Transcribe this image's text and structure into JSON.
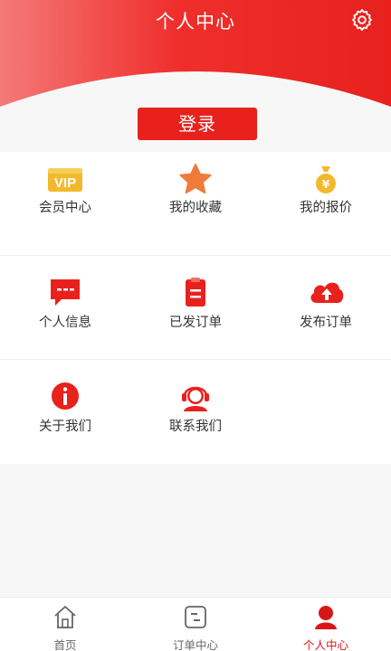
{
  "header": {
    "title": "个人中心"
  },
  "login": {
    "label": "登录"
  },
  "menu": {
    "row1": [
      "会员中心",
      "我的收藏",
      "我的报价"
    ],
    "row2": [
      "个人信息",
      "已发订单",
      "发布订单"
    ],
    "row3": [
      "关于我们",
      "联系我们"
    ]
  },
  "tabs": [
    {
      "label": "首页"
    },
    {
      "label": "订单中心"
    },
    {
      "label": "个人中心"
    }
  ],
  "colors": {
    "accent": "#e8211d",
    "gold": "#f3b92c",
    "active_tab": "#d91616"
  }
}
